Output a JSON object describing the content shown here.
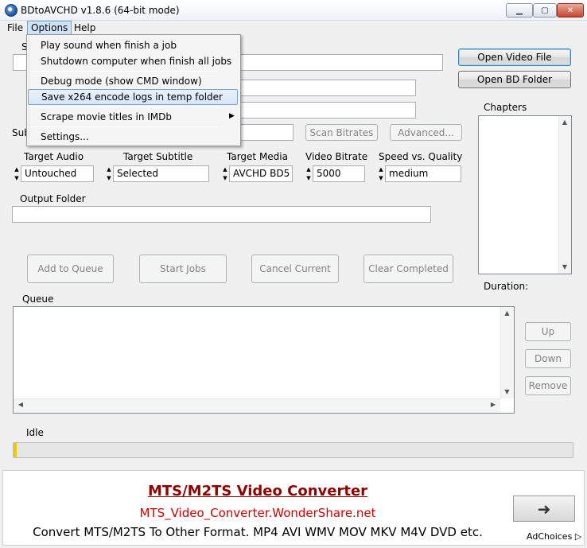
{
  "window": {
    "title": "BDtoAVCHD v1.8.6  (64-bit mode)"
  },
  "menubar": {
    "file": "File",
    "options": "Options",
    "help": "Help"
  },
  "options_menu": {
    "items": [
      "Play sound when finish a job",
      "Shutdown computer when finish all jobs",
      "Debug mode (show CMD window)",
      "Save x264 encode logs in temp folder",
      "Scrape movie titles in IMDb",
      "Settings..."
    ],
    "highlighted_index": 3,
    "submenu_arrow": "▶"
  },
  "source": {
    "label_partial": "S",
    "subtitle_label_partial": "Sub"
  },
  "buttons": {
    "open_video": "Open Video File",
    "open_bd": "Open BD Folder",
    "scan_bitrates": "Scan Bitrates",
    "advanced": "Advanced...",
    "add_queue": "Add to Queue",
    "start_jobs": "Start Jobs",
    "cancel_current": "Cancel Current",
    "clear_completed": "Clear Completed",
    "up": "Up",
    "down": "Down",
    "remove": "Remove"
  },
  "settings": {
    "target_audio": {
      "label": "Target Audio",
      "value": "Untouched"
    },
    "target_subtitle": {
      "label": "Target Subtitle",
      "value": "Selected"
    },
    "target_media": {
      "label": "Target Media",
      "value": "AVCHD BD5"
    },
    "video_bitrate": {
      "label": "Video Bitrate",
      "value": "5000"
    },
    "speed_quality": {
      "label": "Speed vs. Quality",
      "value": "medium"
    }
  },
  "output": {
    "label": "Output Folder",
    "value": ""
  },
  "chapters": {
    "label": "Chapters",
    "duration_label": "Duration:"
  },
  "queue": {
    "label": "Queue"
  },
  "status": {
    "text": "Idle",
    "progress": 0.005
  },
  "ad": {
    "title": "MTS/M2TS Video Converter",
    "url": "MTS_Video_Converter.WonderShare.net",
    "body": "Convert MTS/M2TS To Other Format. MP4 AVI WMV MOV MKV M4V DVD etc.",
    "adchoices": "AdChoices",
    "arrow": "➜"
  },
  "colors": {
    "accent": "#cfe3f7",
    "ad_title": "#8b0000",
    "ad_url": "#cc0000",
    "progress": "#f0c800"
  }
}
